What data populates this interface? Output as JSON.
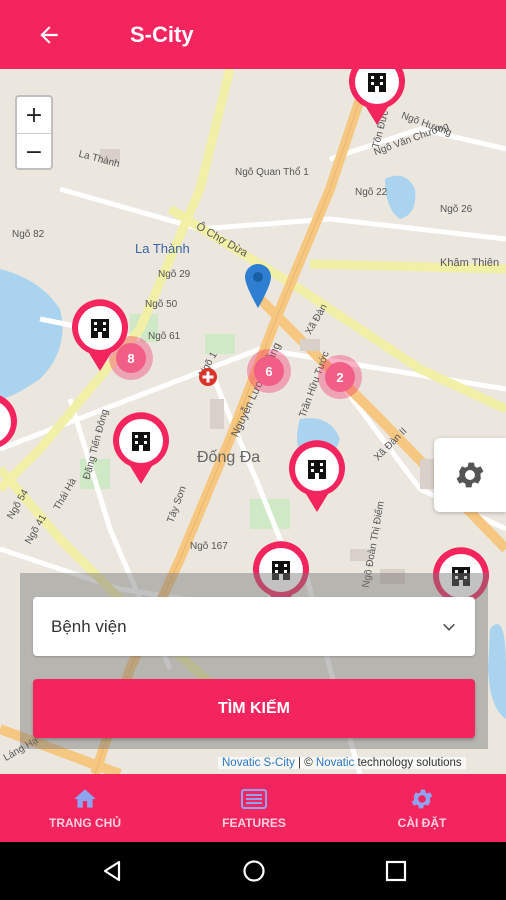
{
  "appbar": {
    "title": "S-City",
    "back_icon": "arrow-left-icon"
  },
  "map": {
    "zoom_in": "+",
    "zoom_out": "−",
    "places": {
      "la_thanh": "La Thành",
      "dong_da": "Đống Đa",
      "dong_da_lake": "Đống\nĐa"
    },
    "street_labels": [
      "La Thành",
      "Ô Chợ Dừa",
      "Ngõ 82",
      "Ngõ 29",
      "Ngõ 50",
      "Ngõ 61",
      "Ngõ 1",
      "Nguyễn Lương Bằng",
      "Tây Sơn",
      "Trần Hữu Tước",
      "Xã Đàn",
      "Khâm Thiên",
      "Ngõ Văn Chương",
      "Ngõ 22",
      "Ngõ Quan Thổ 1",
      "Đặng Tiến Đông",
      "Thái Hà",
      "Ngõ 41",
      "Ngõ 54",
      "Láng Hạ",
      "Xã Đàn II",
      "Ngõ 167",
      "Ngõ Đoàn Thị Điểm",
      "Tôn Đức Thắng",
      "Ngõ Hương",
      "Ngõ 26"
    ],
    "pins": [
      {
        "id": "top",
        "icon": "hospital-building-icon"
      },
      {
        "id": "left",
        "icon": "hospital-building-icon"
      },
      {
        "id": "center-left",
        "icon": "hospital-building-icon"
      },
      {
        "id": "center-right",
        "icon": "hospital-building-icon"
      },
      {
        "id": "bottom-mid",
        "icon": "hospital-building-icon"
      },
      {
        "id": "bottom-right",
        "icon": "hospital-building-icon"
      },
      {
        "id": "far-left",
        "icon": "hospital-building-icon"
      }
    ],
    "clusters": [
      "8",
      "6",
      "2"
    ],
    "location_marker_icon": "map-marker-icon",
    "settings_icon": "gear-icon"
  },
  "search": {
    "selected_category": "Bệnh viện",
    "button_label": "TÌM KIẾM"
  },
  "attribution": {
    "part1": "Novatic S-City",
    "sep": " | © ",
    "part2": "Novatic",
    "part3": " technology solutions"
  },
  "bottom_nav": [
    {
      "label": "TRANG CHỦ",
      "icon": "home-icon"
    },
    {
      "label": "FEATURES",
      "icon": "list-card-icon"
    },
    {
      "label": "CÀI ĐẶT",
      "icon": "gear-icon"
    }
  ],
  "system_nav": [
    "back-triangle-icon",
    "home-circle-icon",
    "recents-square-icon"
  ],
  "colors": {
    "accent": "#f4245f",
    "road_major": "#f6c781",
    "road_yellow": "#f2efa6",
    "water": "#a9d3ee"
  }
}
